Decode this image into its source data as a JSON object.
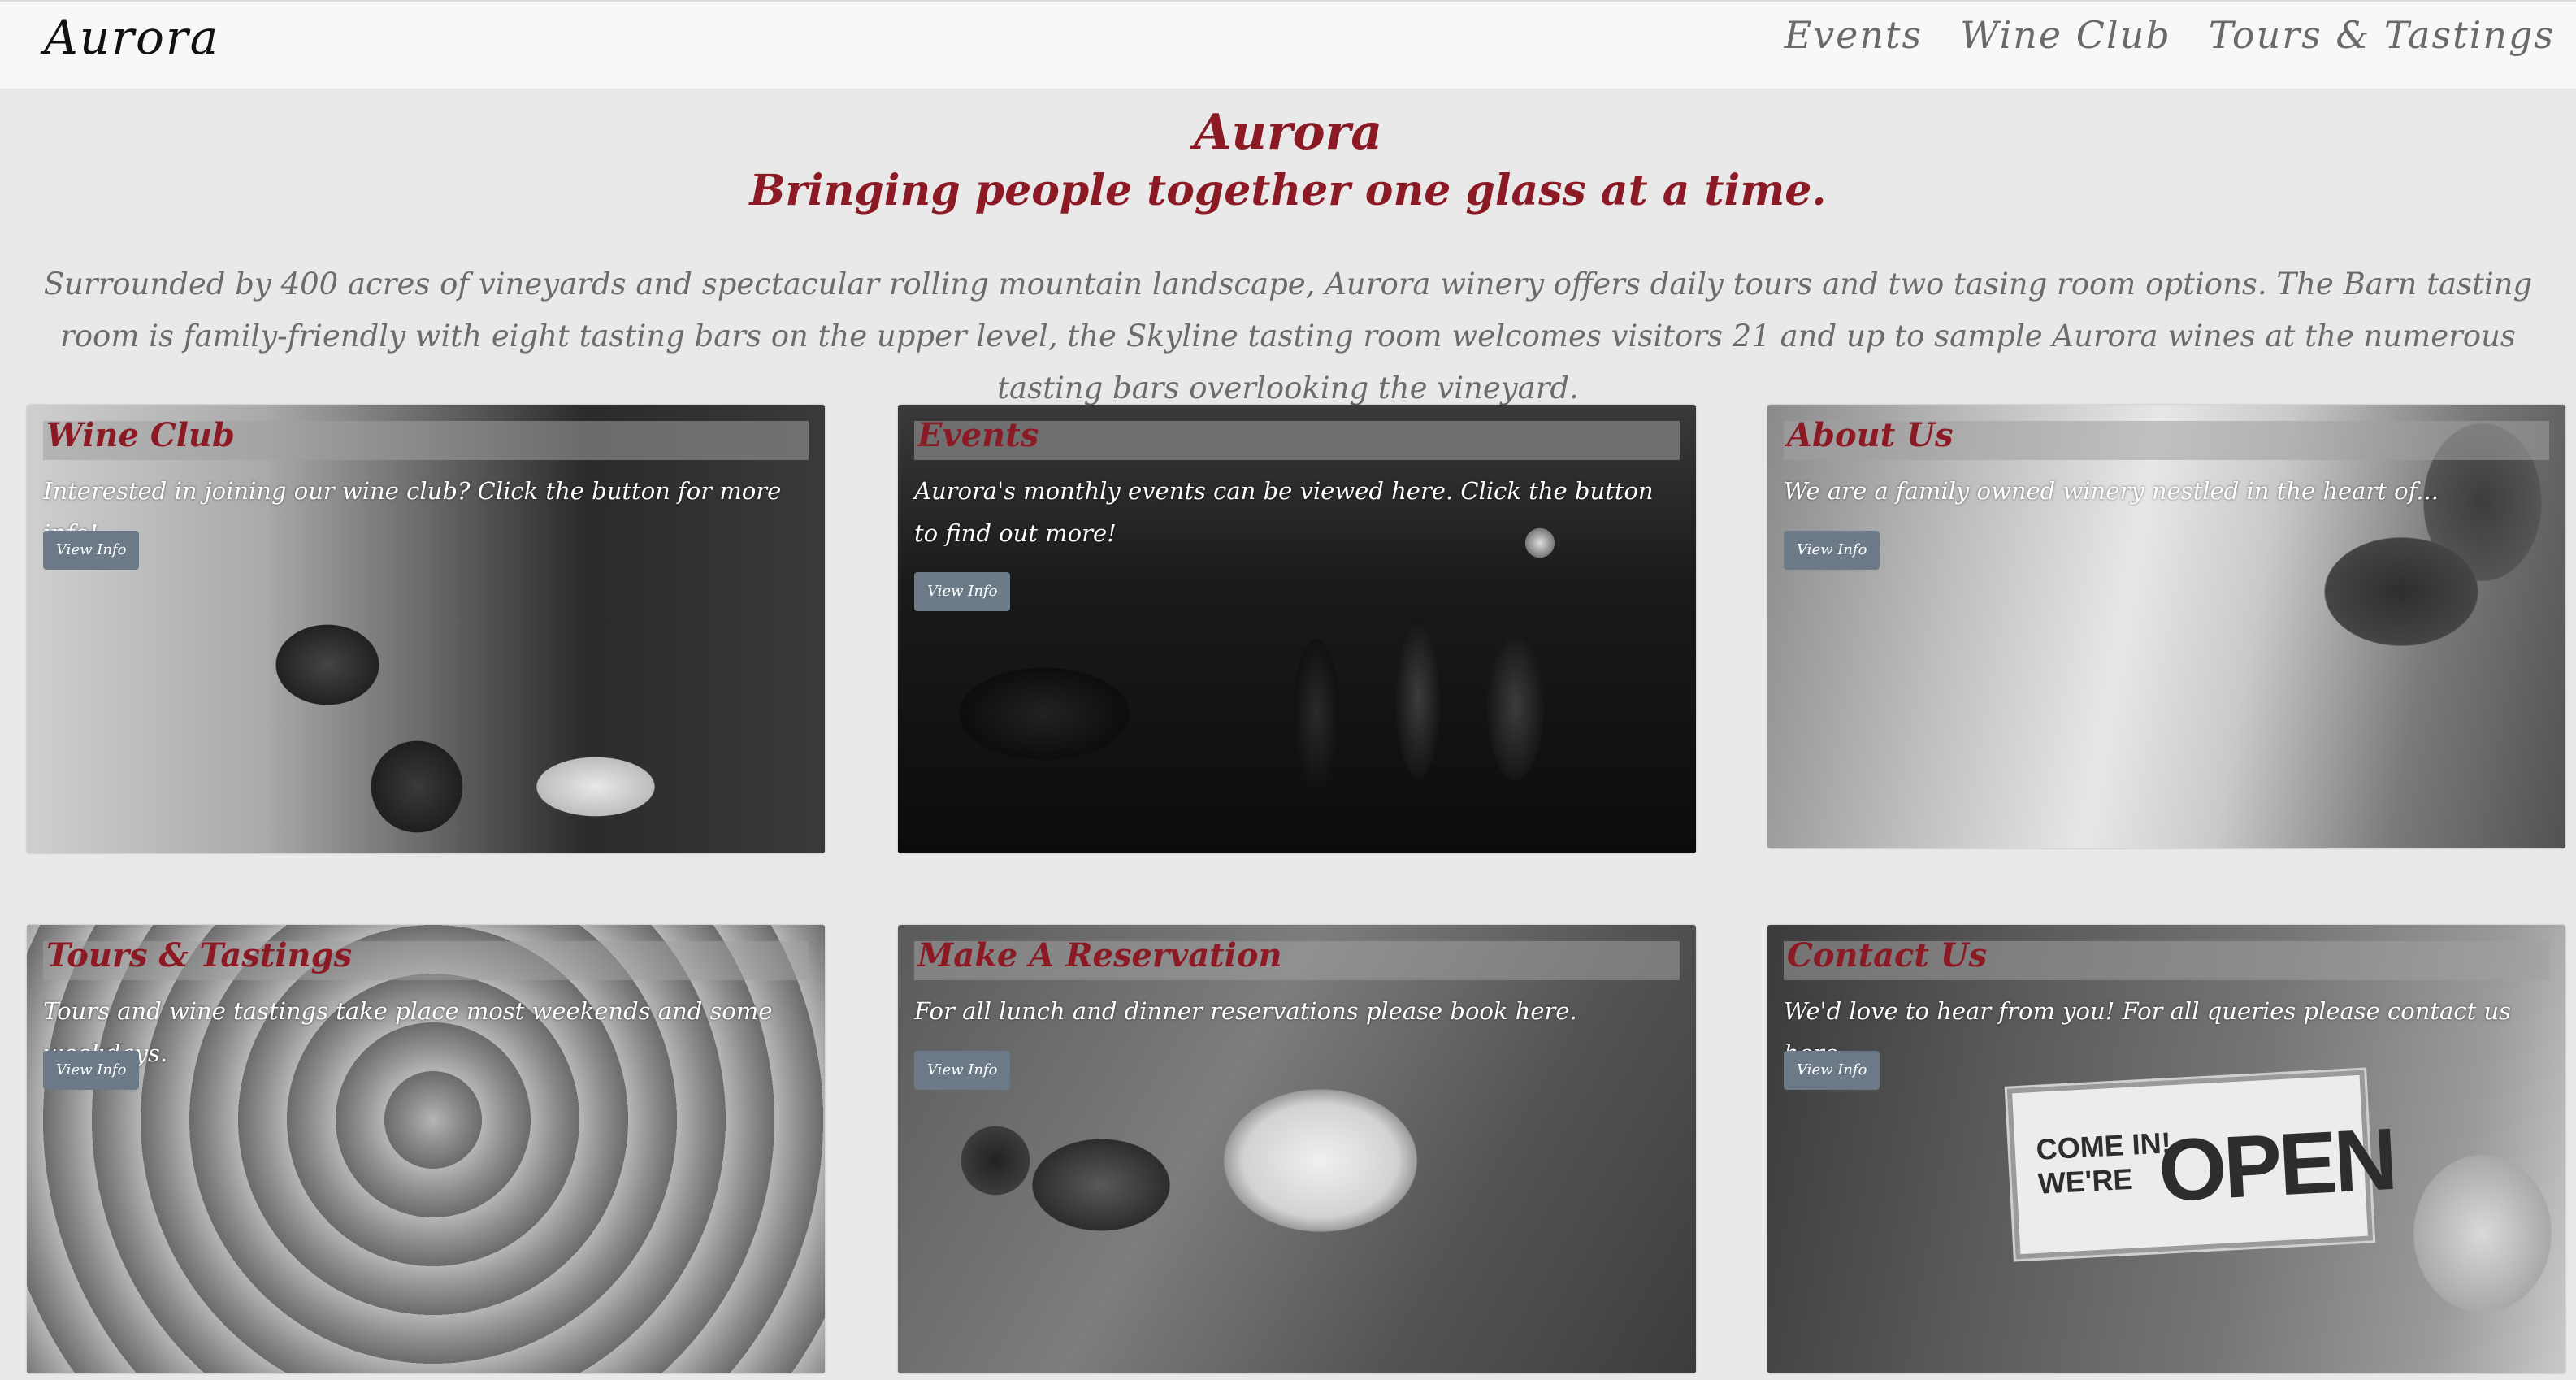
{
  "navbar": {
    "brand": "Aurora",
    "links": [
      "Events",
      "Wine Club",
      "Tours & Tastings"
    ]
  },
  "hero": {
    "title": "Aurora",
    "tagline": "Bringing people together one glass at a time.",
    "description": "Surrounded by 400 acres of vineyards and spectacular rolling mountain landscape, Aurora winery offers daily tours and two tasing room options. The Barn tasting room is family-friendly with eight tasting bars on the upper level, the Skyline tasting room welcomes visitors 21 and up to sample Aurora wines at the numerous tasting bars overlooking the vineyard."
  },
  "cards": [
    {
      "title": "Wine Club",
      "text": "Interested in joining our wine club? Click the button for more info!",
      "button": "View Info"
    },
    {
      "title": "Events",
      "text": "Aurora's monthly events can be viewed here. Click the button to find out more!",
      "button": "View Info"
    },
    {
      "title": "About Us",
      "text": "We are a family owned winery nestled in the heart of...",
      "button": "View Info"
    },
    {
      "title": "Tours & Tastings",
      "text": "Tours and wine tastings take place most weekends and some weekdays.",
      "button": "View Info"
    },
    {
      "title": "Make A Reservation",
      "text": "For all lunch and dinner reservations please book here.",
      "button": "View Info"
    },
    {
      "title": "Contact Us",
      "text": "We'd love to hear from you! For all queries please contact us here.",
      "button": "View Info",
      "sign": {
        "line1": "COME IN!",
        "line2": "WE'RE",
        "big": "OPEN"
      }
    }
  ],
  "colors": {
    "accent": "#8c1a24",
    "button": "#6b7a86",
    "background": "#e9e9e9",
    "navbar": "#f7f8f9"
  }
}
